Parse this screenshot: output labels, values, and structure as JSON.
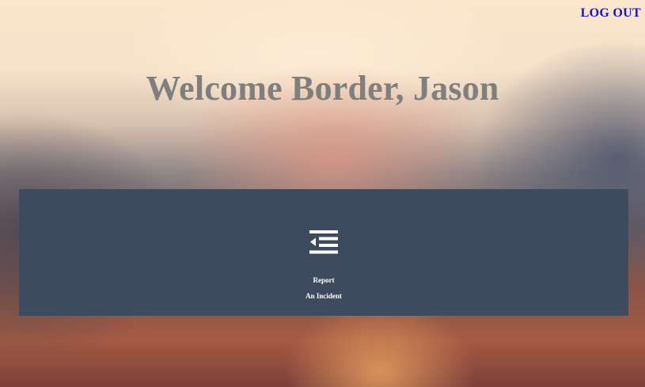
{
  "header": {
    "logout_label": "LOG OUT"
  },
  "main": {
    "welcome_text": "Welcome Border, Jason"
  },
  "panel": {
    "tiles": [
      {
        "icon": "report-list-icon",
        "label_line1": "Report",
        "label_line2": "An Incident"
      }
    ]
  },
  "colors": {
    "panel_bg": "#3e4a5e",
    "logout_link": "#1010e0",
    "welcome_text": "#7f7f7f"
  }
}
